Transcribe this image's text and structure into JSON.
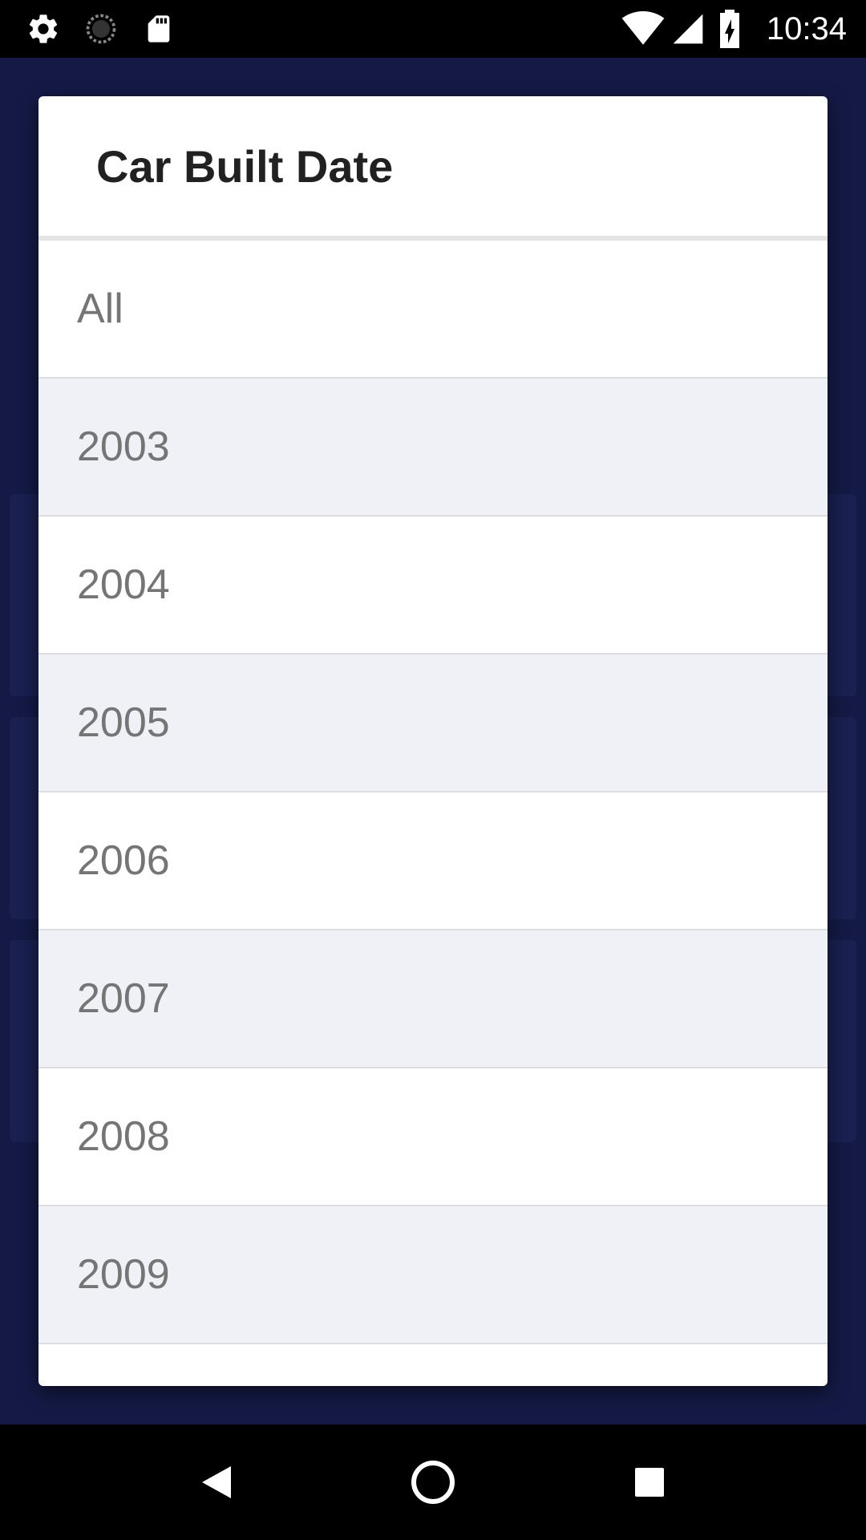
{
  "status_bar": {
    "time": "10:34",
    "icons": [
      "gear-icon",
      "sync-icon",
      "sd-card-icon",
      "wifi-icon",
      "signal-icon",
      "battery-charging-icon"
    ]
  },
  "dialog": {
    "title": "Car Built Date",
    "options": [
      {
        "label": "All"
      },
      {
        "label": "2003"
      },
      {
        "label": "2004"
      },
      {
        "label": "2005"
      },
      {
        "label": "2006"
      },
      {
        "label": "2007"
      },
      {
        "label": "2008"
      },
      {
        "label": "2009"
      }
    ]
  },
  "nav_bar": {
    "buttons": [
      "back-icon",
      "home-icon",
      "recents-icon"
    ]
  },
  "colors": {
    "background": "#101538",
    "dialog_bg": "#ffffff",
    "alt_row_bg": "#f0f1f6",
    "text_primary": "#212121",
    "text_secondary": "#757575"
  }
}
